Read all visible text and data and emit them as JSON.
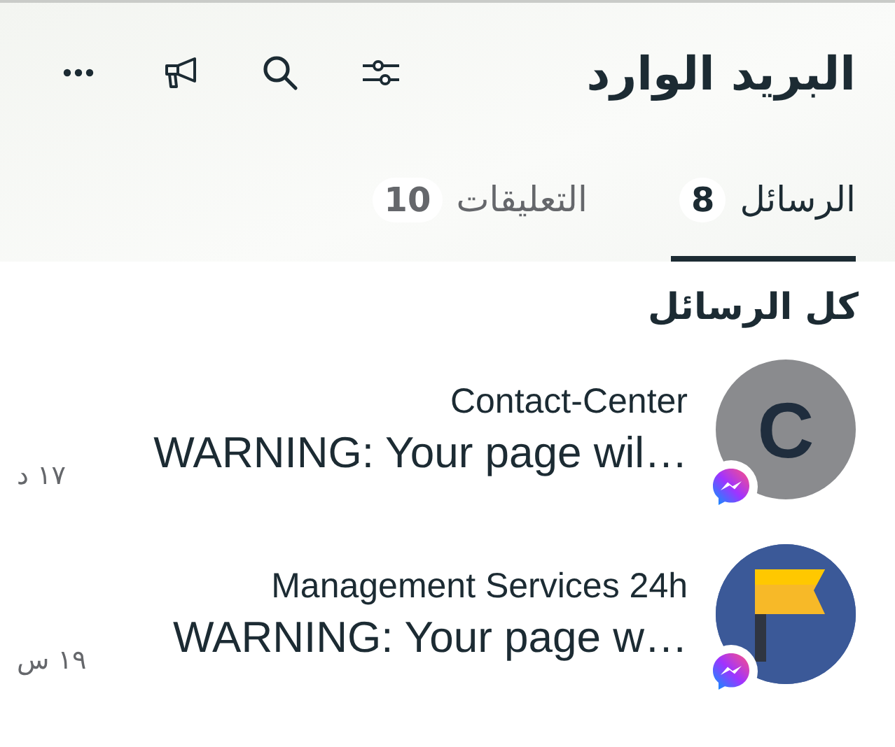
{
  "header": {
    "title": "البريد الوارد"
  },
  "tabs": [
    {
      "label": "الرسائل",
      "count": "8",
      "selected": true
    },
    {
      "label": "التعليقات",
      "count": "10",
      "selected": false
    }
  ],
  "section": {
    "heading": "كل الرسائل"
  },
  "conversations": [
    {
      "name": "Contact-Center",
      "message": "WARNING: Your page wil…",
      "time": "١٧ د",
      "avatar": {
        "kind": "letter",
        "letter": "C"
      },
      "badge": {
        "kind": "messenger"
      }
    },
    {
      "name": "Management Services 24h",
      "message": "WARNING: Your page w…",
      "time": "١٩ س",
      "avatar": {
        "kind": "flag"
      },
      "badge": {
        "kind": "messenger"
      }
    }
  ]
}
